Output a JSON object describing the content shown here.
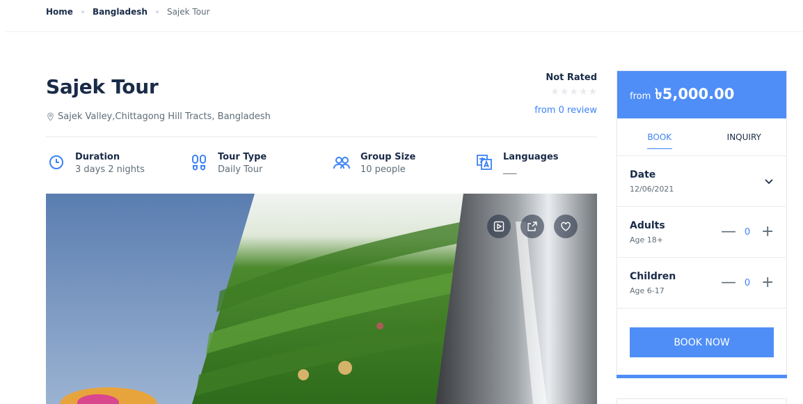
{
  "breadcrumb": {
    "items": [
      "Home",
      "Bangladesh",
      "Sajek Tour"
    ]
  },
  "tour": {
    "title": "Sajek Tour",
    "location": "Sajek Valley,Chittagong Hill Tracts, Bangladesh",
    "rating_text": "Not Rated",
    "stars": 5,
    "reviews": "from 0 review"
  },
  "meta": [
    {
      "label": "Duration",
      "value": "3 days 2 nights",
      "icon": "clock-icon"
    },
    {
      "label": "Tour Type",
      "value": "Daily Tour",
      "icon": "footprints-icon"
    },
    {
      "label": "Group Size",
      "value": "10 people",
      "icon": "people-icon"
    },
    {
      "label": "Languages",
      "value": "___",
      "icon": "translate-icon"
    }
  ],
  "gallery": {
    "actions": [
      "video-icon",
      "share-icon",
      "heart-icon"
    ]
  },
  "booking": {
    "from_label": "from",
    "price": "৳5,000.00",
    "tabs": [
      "BOOK",
      "INQUIRY"
    ],
    "date": {
      "label": "Date",
      "value": "12/06/2021"
    },
    "adults": {
      "label": "Adults",
      "sub": "Age 18+",
      "count": "0"
    },
    "children": {
      "label": "Children",
      "sub": "Age 6-17",
      "count": "0"
    },
    "book_now": "BOOK NOW",
    "minus": "—",
    "plus": "+"
  },
  "colors": {
    "accent": "#4f8ef7",
    "text": "#1a2b48",
    "muted": "#5e6d77"
  }
}
